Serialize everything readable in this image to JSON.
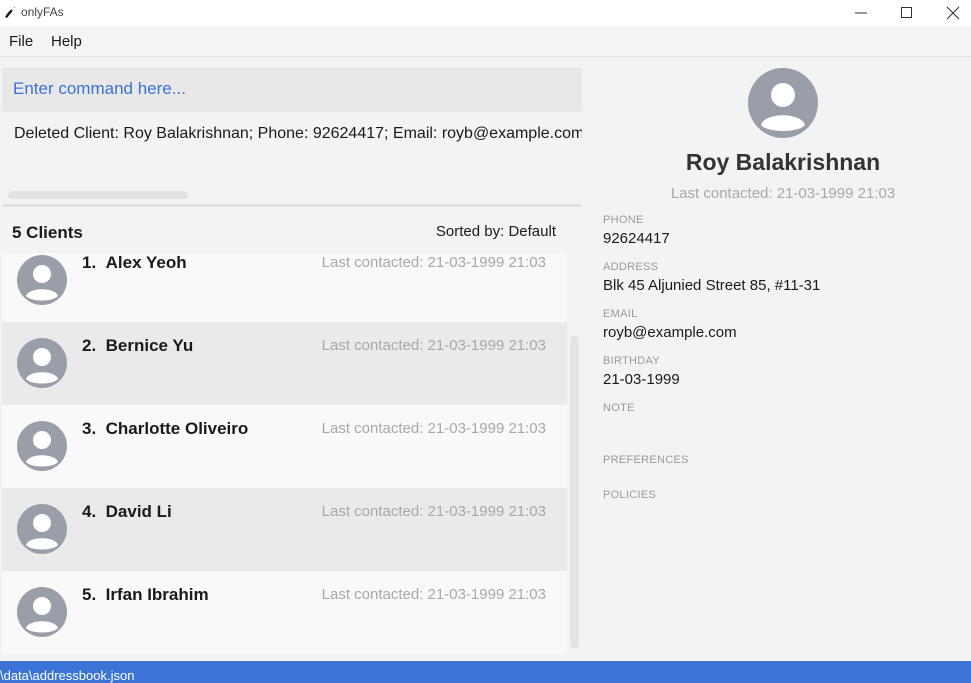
{
  "window": {
    "title": "onlyFAs",
    "icon": "app-logo-icon"
  },
  "menu": {
    "file": "File",
    "help": "Help"
  },
  "command": {
    "placeholder": "Enter command here..."
  },
  "result": {
    "text": "Deleted Client: Roy Balakrishnan; Phone: 92624417; Email: royb@example.com"
  },
  "list": {
    "count_label": "5 Clients",
    "sort_label": "Sorted by: Default",
    "clients": [
      {
        "index": "1.",
        "name": "Alex Yeoh",
        "last": "Last contacted: 21-03-1999 21:03"
      },
      {
        "index": "2.",
        "name": "Bernice Yu",
        "last": "Last contacted: 21-03-1999 21:03"
      },
      {
        "index": "3.",
        "name": "Charlotte Oliveiro",
        "last": "Last contacted: 21-03-1999 21:03"
      },
      {
        "index": "4.",
        "name": "David Li",
        "last": "Last contacted: 21-03-1999 21:03"
      },
      {
        "index": "5.",
        "name": "Irfan Ibrahim",
        "last": "Last contacted: 21-03-1999 21:03"
      }
    ]
  },
  "detail": {
    "name": "Roy Balakrishnan",
    "last": "Last contacted: 21-03-1999 21:03",
    "phone_label": "PHONE",
    "phone": "92624417",
    "address_label": "ADDRESS",
    "address": "Blk 45 Aljunied Street 85, #11-31",
    "email_label": "EMAIL",
    "email": "royb@example.com",
    "birthday_label": "BIRTHDAY",
    "birthday": "21-03-1999",
    "note_label": "NOTE",
    "preferences_label": "PREFERENCES",
    "policies_label": "POLICIES"
  },
  "status": {
    "path": "\\data\\addressbook.json"
  },
  "colors": {
    "accent": "#3b74d6",
    "command_text": "#3a72d6",
    "muted": "#a8a8a8"
  }
}
